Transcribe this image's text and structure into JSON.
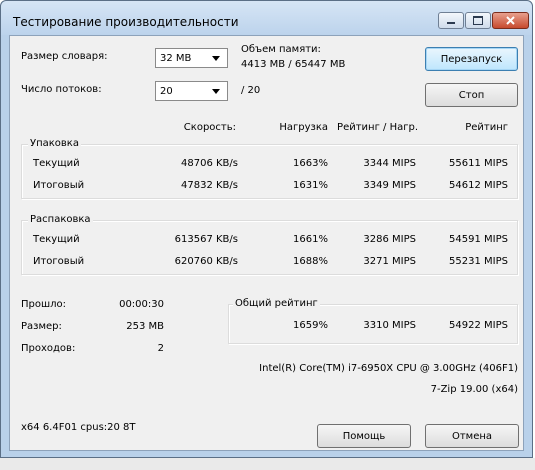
{
  "window": {
    "title": "Тестирование производительности"
  },
  "settings": {
    "dict_label": "Размер словаря:",
    "dict_value": "32 MB",
    "threads_label": "Число потоков:",
    "threads_value": "20",
    "threads_total": "/ 20",
    "memory_label": "Объем памяти:",
    "memory_value": "4413 MB / 65447 MB"
  },
  "buttons": {
    "restart": "Перезапуск",
    "stop": "Стоп",
    "help": "Помощь",
    "cancel": "Отмена"
  },
  "headers": {
    "speed": "Скорость:",
    "load": "Нагрузка",
    "rating_load": "Рейтинг / Нагр.",
    "rating": "Рейтинг"
  },
  "compress": {
    "title": "Упаковка",
    "rows": [
      {
        "label": "Текущий",
        "speed": "48706 KB/s",
        "load": "1663%",
        "rating_load": "3344 MIPS",
        "rating": "55611 MIPS"
      },
      {
        "label": "Итоговый",
        "speed": "47832 KB/s",
        "load": "1631%",
        "rating_load": "3349 MIPS",
        "rating": "54612 MIPS"
      }
    ]
  },
  "decompress": {
    "title": "Распаковка",
    "rows": [
      {
        "label": "Текущий",
        "speed": "613567 KB/s",
        "load": "1661%",
        "rating_load": "3286 MIPS",
        "rating": "54591 MIPS"
      },
      {
        "label": "Итоговый",
        "speed": "620760 KB/s",
        "load": "1688%",
        "rating_load": "3271 MIPS",
        "rating": "55231 MIPS"
      }
    ]
  },
  "stats": {
    "elapsed_label": "Прошло:",
    "elapsed_value": "00:00:30",
    "size_label": "Размер:",
    "size_value": "253 MB",
    "passes_label": "Проходов:",
    "passes_value": "2"
  },
  "total": {
    "title": "Общий рейтинг",
    "load": "1659%",
    "rating_load": "3310 MIPS",
    "rating": "54922 MIPS"
  },
  "cpu": "Intel(R) Core(TM) i7-6950X CPU @ 3.00GHz (406F1)",
  "version": "7-Zip 19.00 (x64)",
  "sysinfo": "x64 6.4F01 cpus:20 8T"
}
